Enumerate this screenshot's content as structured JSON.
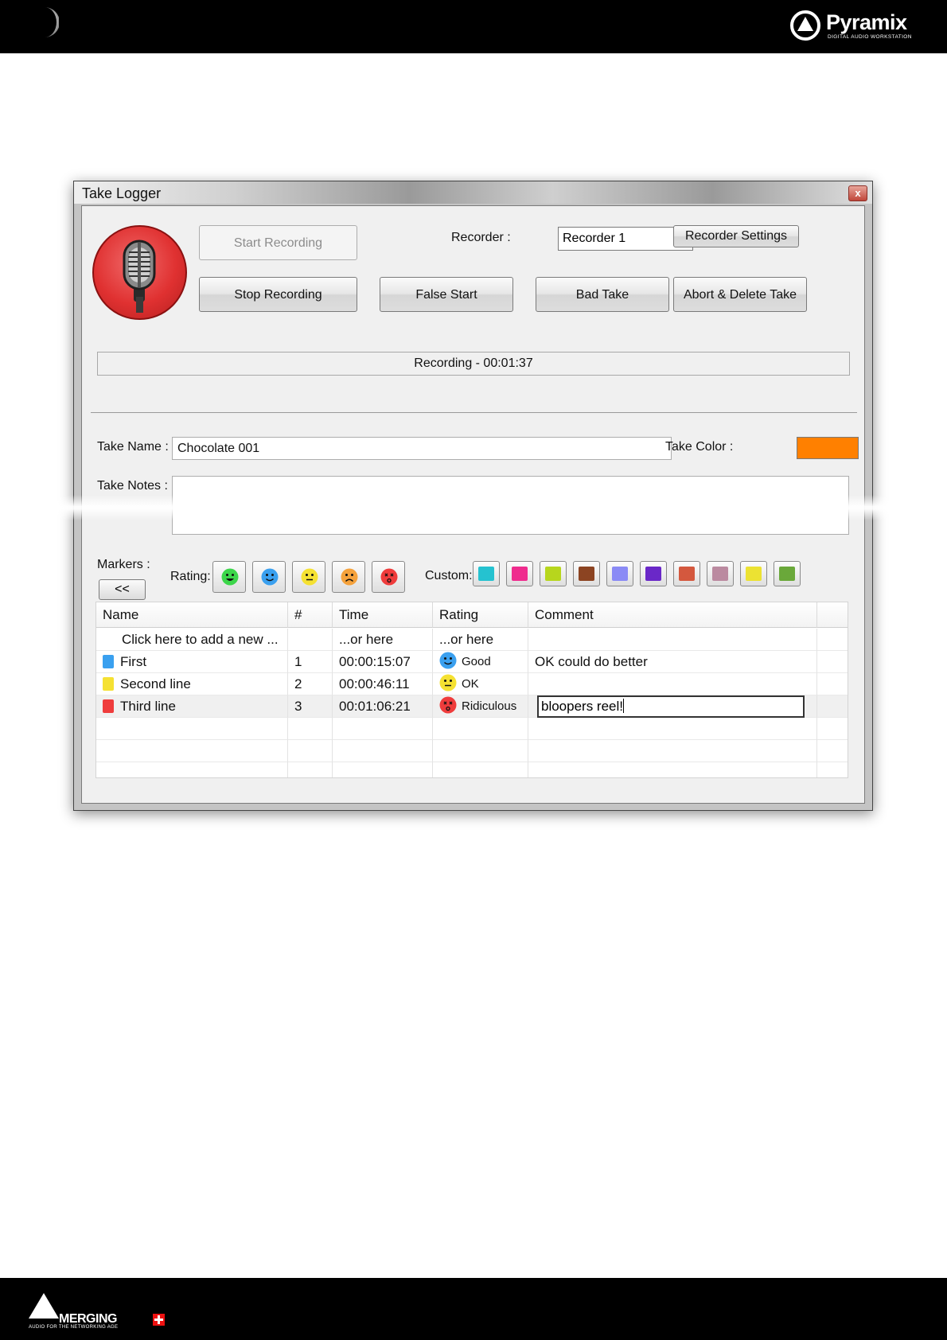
{
  "header": {
    "brand": "Pyramix",
    "tagline": "DIGITAL AUDIO WORKSTATION"
  },
  "footer": {
    "brand": "MERGING",
    "tagline": "AUDIO FOR THE NETWORKING AGE"
  },
  "window": {
    "title": "Take Logger",
    "close_label": "x"
  },
  "controls": {
    "start_recording": "Start Recording",
    "stop_recording": "Stop Recording",
    "false_start": "False Start",
    "bad_take": "Bad Take",
    "abort_delete": "Abort & Delete Take",
    "recorder_label": "Recorder :",
    "recorder_value": "Recorder 1",
    "recorder_settings": "Recorder Settings"
  },
  "status": "Recording - 00:01:37",
  "take": {
    "name_label": "Take Name :",
    "name_value": "Chocolate 001",
    "color_label": "Take Color :",
    "color": "#ff8000",
    "notes_label": "Take Notes :",
    "notes_value": ""
  },
  "markers": {
    "label": "Markers :",
    "back_button": "<<",
    "rating_label": "Rating:",
    "ratings": [
      {
        "icon": "very-happy-face-icon",
        "color": "#3cd64a"
      },
      {
        "icon": "happy-face-icon",
        "color": "#3aa0ef"
      },
      {
        "icon": "neutral-face-icon",
        "color": "#f5e132"
      },
      {
        "icon": "sad-face-icon",
        "color": "#f5a23c"
      },
      {
        "icon": "dead-face-icon",
        "color": "#ef3c3c"
      }
    ],
    "custom_label": "Custom:",
    "custom_colors": [
      "#25c2d0",
      "#ef2c8e",
      "#b7d61d",
      "#8c4422",
      "#8a8af5",
      "#6a28c8",
      "#d4583e",
      "#bb8aa0",
      "#ece232",
      "#6aa83a"
    ]
  },
  "grid": {
    "columns": [
      "Name",
      "#",
      "Time",
      "Rating",
      "Comment"
    ],
    "add_row": {
      "name": "Click here to add a new ...",
      "time": "...or here",
      "rating": "...or here"
    },
    "rows": [
      {
        "color": "#3aa0ef",
        "name": "First",
        "num": "1",
        "time": "00:00:15:07",
        "rating": "Good",
        "rating_icon": "happy-face-icon",
        "rating_color": "#3aa0ef",
        "comment": "OK could do better"
      },
      {
        "color": "#f5e132",
        "name": "Second line",
        "num": "2",
        "time": "00:00:46:11",
        "rating": "OK",
        "rating_icon": "neutral-face-icon",
        "rating_color": "#f5e132",
        "comment": ""
      },
      {
        "color": "#ef3c3c",
        "name": "Third line",
        "num": "3",
        "time": "00:01:06:21",
        "rating": "Ridiculous",
        "rating_icon": "dead-face-icon",
        "rating_color": "#ef3c3c",
        "comment": "bloopers reel!"
      }
    ]
  }
}
